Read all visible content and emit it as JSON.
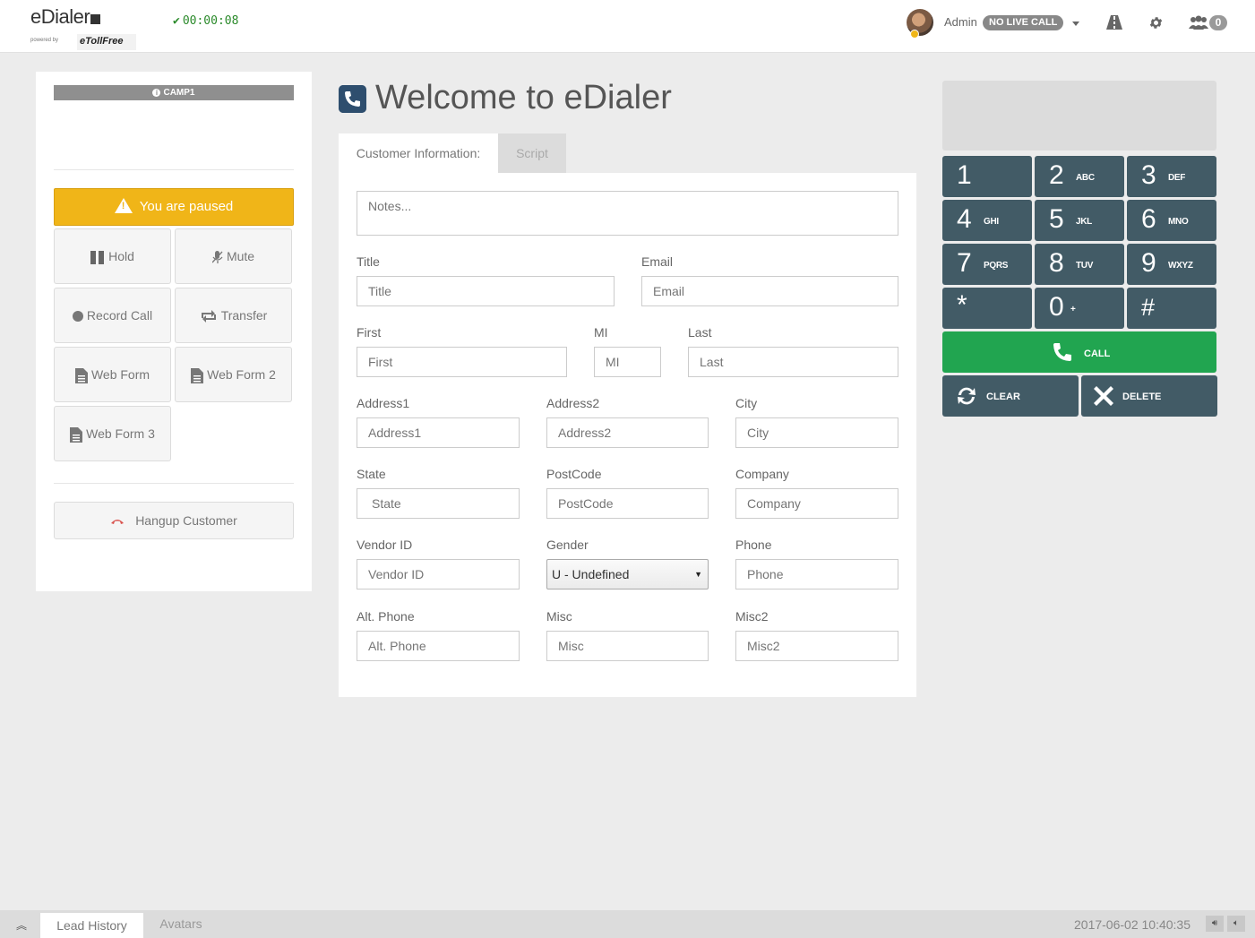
{
  "header": {
    "logo": "eDialer",
    "logo_sub": "powered by",
    "logo_partner": "eTollFree",
    "timer": "00:00:08",
    "user_name": "Admin",
    "call_status": "NO LIVE CALL",
    "users_count": "0"
  },
  "left": {
    "campaign": "CAMP1",
    "paused_label": "You are paused",
    "buttons": {
      "hold": "Hold",
      "mute": "Mute",
      "record": "Record Call",
      "transfer": "Transfer",
      "webform": "Web Form",
      "webform2": "Web Form 2",
      "webform3": "Web Form 3",
      "hangup": "Hangup Customer"
    }
  },
  "main": {
    "title": "Welcome to eDialer",
    "tabs": [
      "Customer Information:",
      "Script"
    ],
    "notes_placeholder": "Notes...",
    "fields": {
      "title": {
        "label": "Title",
        "placeholder": "Title"
      },
      "email": {
        "label": "Email",
        "placeholder": "Email"
      },
      "first": {
        "label": "First",
        "placeholder": "First"
      },
      "mi": {
        "label": "MI",
        "placeholder": "MI"
      },
      "last": {
        "label": "Last",
        "placeholder": "Last"
      },
      "address1": {
        "label": "Address1",
        "placeholder": "Address1"
      },
      "address2": {
        "label": "Address2",
        "placeholder": "Address2"
      },
      "city": {
        "label": "City",
        "placeholder": "City"
      },
      "state": {
        "label": "State",
        "placeholder": "State"
      },
      "postcode": {
        "label": "PostCode",
        "placeholder": "PostCode"
      },
      "company": {
        "label": "Company",
        "placeholder": "Company"
      },
      "vendor": {
        "label": "Vendor ID",
        "placeholder": "Vendor ID"
      },
      "gender": {
        "label": "Gender",
        "value": "U - Undefined"
      },
      "phone": {
        "label": "Phone",
        "placeholder": "Phone"
      },
      "altphone": {
        "label": "Alt. Phone",
        "placeholder": "Alt. Phone"
      },
      "misc": {
        "label": "Misc",
        "placeholder": "Misc"
      },
      "misc2": {
        "label": "Misc2",
        "placeholder": "Misc2"
      }
    }
  },
  "dialpad": {
    "keys": [
      {
        "num": "1",
        "sub": ""
      },
      {
        "num": "2",
        "sub": "ABC"
      },
      {
        "num": "3",
        "sub": "DEF"
      },
      {
        "num": "4",
        "sub": "GHI"
      },
      {
        "num": "5",
        "sub": "JKL"
      },
      {
        "num": "6",
        "sub": "MNO"
      },
      {
        "num": "7",
        "sub": "PQRS"
      },
      {
        "num": "8",
        "sub": "TUV"
      },
      {
        "num": "9",
        "sub": "WXYZ"
      },
      {
        "num": "*",
        "sub": ""
      },
      {
        "num": "0",
        "sub": "+"
      },
      {
        "num": "#",
        "sub": ""
      }
    ],
    "call": "CALL",
    "clear": "CLEAR",
    "delete": "DELETE"
  },
  "footer": {
    "tabs": [
      "Lead History",
      "Avatars"
    ],
    "datetime": "2017-06-02 10:40:35"
  },
  "colors": {
    "paused": "#f0b518",
    "call": "#21a550",
    "keypad": "#425b66",
    "timer": "#2a8a2a"
  }
}
